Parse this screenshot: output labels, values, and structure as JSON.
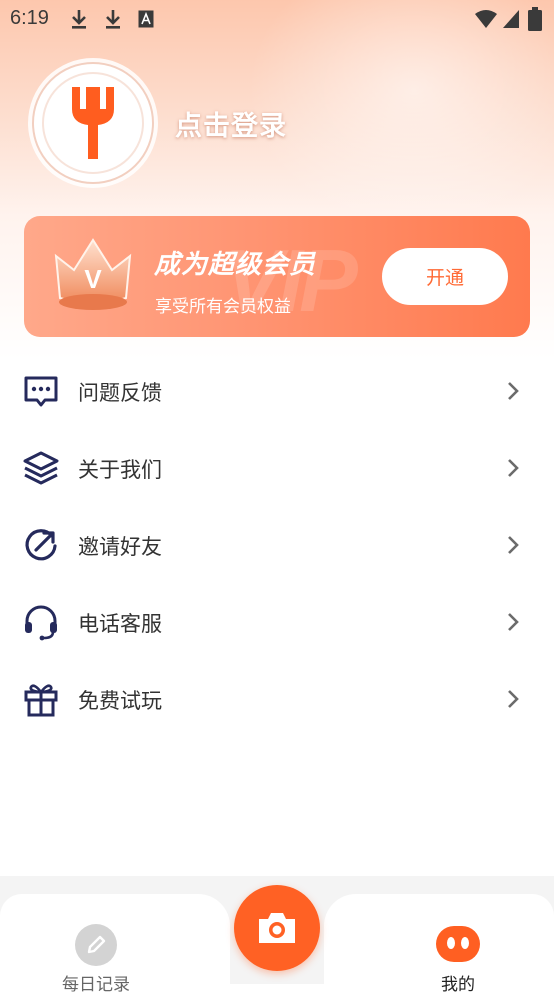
{
  "status_bar": {
    "time": "6:19",
    "icons": [
      "download-icon",
      "download-icon",
      "text-a-icon",
      "wifi-icon",
      "signal-icon",
      "battery-icon"
    ]
  },
  "profile": {
    "avatar_icon": "fork-icon",
    "login_text": "点击登录"
  },
  "vip": {
    "title": "成为超级会员",
    "subtitle": "享受所有会员权益",
    "button_label": "开通",
    "watermark": "VIP",
    "badge_letter": "V"
  },
  "menu": [
    {
      "label": "问题反馈",
      "icon": "chat-bubble-icon"
    },
    {
      "label": "关于我们",
      "icon": "layers-icon"
    },
    {
      "label": "邀请好友",
      "icon": "share-circle-icon"
    },
    {
      "label": "电话客服",
      "icon": "headset-icon"
    },
    {
      "label": "免费试玩",
      "icon": "gift-icon"
    }
  ],
  "bottom_nav": {
    "tabs": [
      {
        "label": "每日记录",
        "icon": "pencil-icon",
        "active": false
      },
      {
        "label": "我的",
        "icon": "face-icon",
        "active": true
      }
    ],
    "center_icon": "camera-icon"
  },
  "colors": {
    "accent": "#ff6124",
    "menu_icon": "#252a5c",
    "nav_inactive": "#666666",
    "nav_active": "#222222"
  }
}
